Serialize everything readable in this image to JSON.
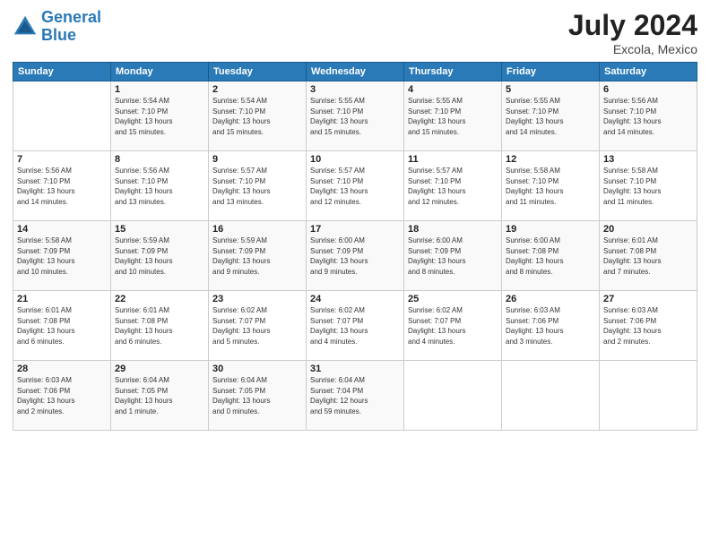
{
  "header": {
    "logo_general": "General",
    "logo_blue": "Blue",
    "month_year": "July 2024",
    "location": "Excola, Mexico"
  },
  "weekdays": [
    "Sunday",
    "Monday",
    "Tuesday",
    "Wednesday",
    "Thursday",
    "Friday",
    "Saturday"
  ],
  "weeks": [
    [
      {
        "day": "",
        "info": ""
      },
      {
        "day": "1",
        "info": "Sunrise: 5:54 AM\nSunset: 7:10 PM\nDaylight: 13 hours\nand 15 minutes."
      },
      {
        "day": "2",
        "info": "Sunrise: 5:54 AM\nSunset: 7:10 PM\nDaylight: 13 hours\nand 15 minutes."
      },
      {
        "day": "3",
        "info": "Sunrise: 5:55 AM\nSunset: 7:10 PM\nDaylight: 13 hours\nand 15 minutes."
      },
      {
        "day": "4",
        "info": "Sunrise: 5:55 AM\nSunset: 7:10 PM\nDaylight: 13 hours\nand 15 minutes."
      },
      {
        "day": "5",
        "info": "Sunrise: 5:55 AM\nSunset: 7:10 PM\nDaylight: 13 hours\nand 14 minutes."
      },
      {
        "day": "6",
        "info": "Sunrise: 5:56 AM\nSunset: 7:10 PM\nDaylight: 13 hours\nand 14 minutes."
      }
    ],
    [
      {
        "day": "7",
        "info": "Sunrise: 5:56 AM\nSunset: 7:10 PM\nDaylight: 13 hours\nand 14 minutes."
      },
      {
        "day": "8",
        "info": "Sunrise: 5:56 AM\nSunset: 7:10 PM\nDaylight: 13 hours\nand 13 minutes."
      },
      {
        "day": "9",
        "info": "Sunrise: 5:57 AM\nSunset: 7:10 PM\nDaylight: 13 hours\nand 13 minutes."
      },
      {
        "day": "10",
        "info": "Sunrise: 5:57 AM\nSunset: 7:10 PM\nDaylight: 13 hours\nand 12 minutes."
      },
      {
        "day": "11",
        "info": "Sunrise: 5:57 AM\nSunset: 7:10 PM\nDaylight: 13 hours\nand 12 minutes."
      },
      {
        "day": "12",
        "info": "Sunrise: 5:58 AM\nSunset: 7:10 PM\nDaylight: 13 hours\nand 11 minutes."
      },
      {
        "day": "13",
        "info": "Sunrise: 5:58 AM\nSunset: 7:10 PM\nDaylight: 13 hours\nand 11 minutes."
      }
    ],
    [
      {
        "day": "14",
        "info": "Sunrise: 5:58 AM\nSunset: 7:09 PM\nDaylight: 13 hours\nand 10 minutes."
      },
      {
        "day": "15",
        "info": "Sunrise: 5:59 AM\nSunset: 7:09 PM\nDaylight: 13 hours\nand 10 minutes."
      },
      {
        "day": "16",
        "info": "Sunrise: 5:59 AM\nSunset: 7:09 PM\nDaylight: 13 hours\nand 9 minutes."
      },
      {
        "day": "17",
        "info": "Sunrise: 6:00 AM\nSunset: 7:09 PM\nDaylight: 13 hours\nand 9 minutes."
      },
      {
        "day": "18",
        "info": "Sunrise: 6:00 AM\nSunset: 7:09 PM\nDaylight: 13 hours\nand 8 minutes."
      },
      {
        "day": "19",
        "info": "Sunrise: 6:00 AM\nSunset: 7:08 PM\nDaylight: 13 hours\nand 8 minutes."
      },
      {
        "day": "20",
        "info": "Sunrise: 6:01 AM\nSunset: 7:08 PM\nDaylight: 13 hours\nand 7 minutes."
      }
    ],
    [
      {
        "day": "21",
        "info": "Sunrise: 6:01 AM\nSunset: 7:08 PM\nDaylight: 13 hours\nand 6 minutes."
      },
      {
        "day": "22",
        "info": "Sunrise: 6:01 AM\nSunset: 7:08 PM\nDaylight: 13 hours\nand 6 minutes."
      },
      {
        "day": "23",
        "info": "Sunrise: 6:02 AM\nSunset: 7:07 PM\nDaylight: 13 hours\nand 5 minutes."
      },
      {
        "day": "24",
        "info": "Sunrise: 6:02 AM\nSunset: 7:07 PM\nDaylight: 13 hours\nand 4 minutes."
      },
      {
        "day": "25",
        "info": "Sunrise: 6:02 AM\nSunset: 7:07 PM\nDaylight: 13 hours\nand 4 minutes."
      },
      {
        "day": "26",
        "info": "Sunrise: 6:03 AM\nSunset: 7:06 PM\nDaylight: 13 hours\nand 3 minutes."
      },
      {
        "day": "27",
        "info": "Sunrise: 6:03 AM\nSunset: 7:06 PM\nDaylight: 13 hours\nand 2 minutes."
      }
    ],
    [
      {
        "day": "28",
        "info": "Sunrise: 6:03 AM\nSunset: 7:06 PM\nDaylight: 13 hours\nand 2 minutes."
      },
      {
        "day": "29",
        "info": "Sunrise: 6:04 AM\nSunset: 7:05 PM\nDaylight: 13 hours\nand 1 minute."
      },
      {
        "day": "30",
        "info": "Sunrise: 6:04 AM\nSunset: 7:05 PM\nDaylight: 13 hours\nand 0 minutes."
      },
      {
        "day": "31",
        "info": "Sunrise: 6:04 AM\nSunset: 7:04 PM\nDaylight: 12 hours\nand 59 minutes."
      },
      {
        "day": "",
        "info": ""
      },
      {
        "day": "",
        "info": ""
      },
      {
        "day": "",
        "info": ""
      }
    ]
  ]
}
